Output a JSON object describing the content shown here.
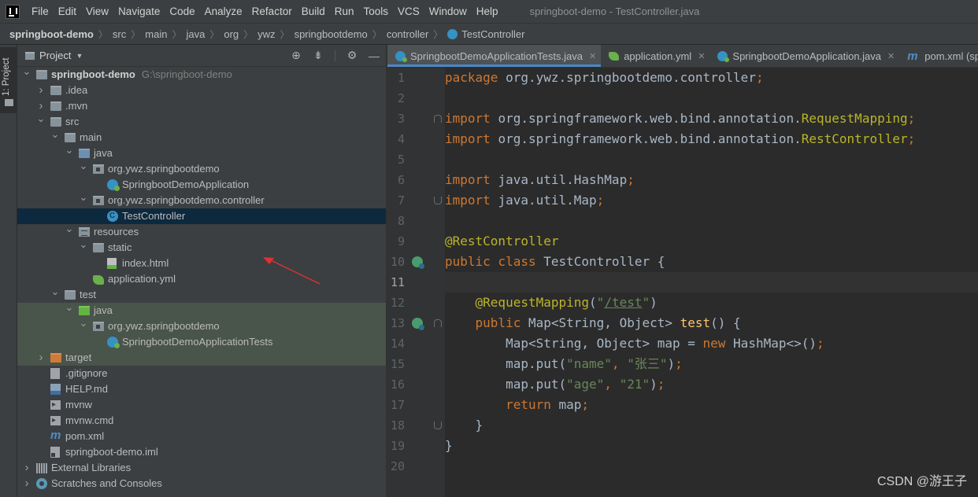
{
  "menu": {
    "items": [
      "File",
      "Edit",
      "View",
      "Navigate",
      "Code",
      "Analyze",
      "Refactor",
      "Build",
      "Run",
      "Tools",
      "VCS",
      "Window",
      "Help"
    ],
    "window_title": "springboot-demo - TestController.java"
  },
  "breadcrumb": [
    "springboot-demo",
    "src",
    "main",
    "java",
    "org",
    "ywz",
    "springbootdemo",
    "controller",
    "TestController"
  ],
  "tool_strip": {
    "project_tab": "1: Project"
  },
  "project_panel": {
    "title": "Project",
    "tree": [
      {
        "depth": 0,
        "expanded": true,
        "icon": "folder-icon",
        "label": "springboot-demo",
        "hint": "G:\\springboot-demo",
        "bold": true
      },
      {
        "depth": 1,
        "expanded": false,
        "icon": "folder-icon",
        "label": ".idea"
      },
      {
        "depth": 1,
        "expanded": false,
        "icon": "folder-icon",
        "label": ".mvn"
      },
      {
        "depth": 1,
        "expanded": true,
        "icon": "folder-icon",
        "label": "src"
      },
      {
        "depth": 2,
        "expanded": true,
        "icon": "folder-icon",
        "label": "main"
      },
      {
        "depth": 3,
        "expanded": true,
        "icon": "source-folder-icon",
        "label": "java"
      },
      {
        "depth": 4,
        "expanded": true,
        "icon": "package-icon",
        "label": "org.ywz.springbootdemo"
      },
      {
        "depth": 5,
        "icon": "spring-boot-class-icon",
        "label": "SpringbootDemoApplication"
      },
      {
        "depth": 4,
        "expanded": true,
        "icon": "package-icon",
        "label": "org.ywz.springbootdemo.controller"
      },
      {
        "depth": 5,
        "icon": "class-icon",
        "label": "TestController",
        "selected": true
      },
      {
        "depth": 3,
        "expanded": true,
        "icon": "resources-folder-icon",
        "label": "resources"
      },
      {
        "depth": 4,
        "expanded": true,
        "icon": "folder-icon",
        "label": "static"
      },
      {
        "depth": 5,
        "icon": "html-file-icon",
        "label": "index.html"
      },
      {
        "depth": 4,
        "icon": "yaml-file-icon",
        "label": "application.yml"
      },
      {
        "depth": 2,
        "expanded": true,
        "icon": "folder-icon",
        "label": "test"
      },
      {
        "depth": 3,
        "expanded": true,
        "icon": "test-source-folder-icon",
        "label": "java",
        "test_source": true
      },
      {
        "depth": 4,
        "expanded": true,
        "icon": "package-icon",
        "label": "org.ywz.springbootdemo",
        "test_source": true
      },
      {
        "depth": 5,
        "icon": "spring-boot-class-icon",
        "label": "SpringbootDemoApplicationTests",
        "test_source": true
      },
      {
        "depth": 1,
        "expanded": false,
        "icon": "excluded-folder-icon",
        "label": "target",
        "test_source": true
      },
      {
        "depth": 1,
        "icon": "gitignore-file-icon",
        "label": ".gitignore"
      },
      {
        "depth": 1,
        "icon": "markdown-file-icon",
        "label": "HELP.md"
      },
      {
        "depth": 1,
        "icon": "script-file-icon",
        "label": "mvnw"
      },
      {
        "depth": 1,
        "icon": "script-file-icon",
        "label": "mvnw.cmd"
      },
      {
        "depth": 1,
        "icon": "maven-icon",
        "label": "pom.xml"
      },
      {
        "depth": 1,
        "icon": "iml-file-icon",
        "label": "springboot-demo.iml"
      },
      {
        "depth": 0,
        "expanded": false,
        "icon": "libraries-icon",
        "label": "External Libraries"
      },
      {
        "depth": 0,
        "expanded": false,
        "icon": "scratches-icon",
        "label": "Scratches and Consoles"
      }
    ]
  },
  "editor_tabs": [
    {
      "label": "SpringbootDemoApplicationTests.java",
      "icon": "spring",
      "active": true
    },
    {
      "label": "application.yml",
      "icon": "yml"
    },
    {
      "label": "SpringbootDemoApplication.java",
      "icon": "spring"
    },
    {
      "label": "pom.xml (sp",
      "icon": "maven"
    }
  ],
  "editor": {
    "current_line": 11,
    "lines": [
      {
        "n": "1",
        "tokens": [
          [
            "kw",
            "package "
          ],
          [
            "plain",
            "org.ywz.springbootdemo.controller"
          ],
          [
            "kw",
            ";"
          ]
        ]
      },
      {
        "n": "2",
        "tokens": []
      },
      {
        "n": "3",
        "fold": "start",
        "tokens": [
          [
            "kw",
            "import "
          ],
          [
            "plain",
            "org.springframework.web.bind.annotation."
          ],
          [
            "ann",
            "RequestMapping"
          ],
          [
            "kw",
            ";"
          ]
        ]
      },
      {
        "n": "4",
        "tokens": [
          [
            "kw",
            "import "
          ],
          [
            "plain",
            "org.springframework.web.bind.annotation."
          ],
          [
            "ann",
            "RestController"
          ],
          [
            "kw",
            ";"
          ]
        ]
      },
      {
        "n": "5",
        "tokens": []
      },
      {
        "n": "6",
        "tokens": [
          [
            "kw",
            "import "
          ],
          [
            "plain",
            "java.util.HashMap"
          ],
          [
            "kw",
            ";"
          ]
        ]
      },
      {
        "n": "7",
        "fold": "end",
        "tokens": [
          [
            "kw",
            "import "
          ],
          [
            "plain",
            "java.util.Map"
          ],
          [
            "kw",
            ";"
          ]
        ]
      },
      {
        "n": "8",
        "tokens": []
      },
      {
        "n": "9",
        "tokens": [
          [
            "ann",
            "@RestController"
          ]
        ]
      },
      {
        "n": "10",
        "bean": true,
        "tokens": [
          [
            "kw",
            "public class "
          ],
          [
            "plain",
            "TestController {"
          ]
        ]
      },
      {
        "n": "11",
        "tokens": []
      },
      {
        "n": "12",
        "tokens": [
          [
            "plain",
            "    "
          ],
          [
            "ann",
            "@RequestMapping"
          ],
          [
            "plain",
            "("
          ],
          [
            "str",
            "\""
          ],
          [
            "str under",
            "/test"
          ],
          [
            "str",
            "\""
          ],
          [
            "plain",
            ")"
          ]
        ]
      },
      {
        "n": "13",
        "bean": true,
        "fold": "start",
        "tokens": [
          [
            "plain",
            "    "
          ],
          [
            "kw",
            "public "
          ],
          [
            "plain",
            "Map<String, Object> "
          ],
          [
            "fn",
            "test"
          ],
          [
            "plain",
            "() {"
          ]
        ]
      },
      {
        "n": "14",
        "tokens": [
          [
            "plain",
            "        Map<String, Object> map = "
          ],
          [
            "kw",
            "new "
          ],
          [
            "plain",
            "HashMap<>()"
          ],
          [
            "kw",
            ";"
          ]
        ]
      },
      {
        "n": "15",
        "tokens": [
          [
            "plain",
            "        map.put("
          ],
          [
            "str",
            "\"name\""
          ],
          [
            "kw",
            ", "
          ],
          [
            "str",
            "\"张三\""
          ],
          [
            "plain",
            ")"
          ],
          [
            "kw",
            ";"
          ]
        ]
      },
      {
        "n": "16",
        "tokens": [
          [
            "plain",
            "        map.put("
          ],
          [
            "str",
            "\"age\""
          ],
          [
            "kw",
            ", "
          ],
          [
            "str",
            "\"21\""
          ],
          [
            "plain",
            ")"
          ],
          [
            "kw",
            ";"
          ]
        ]
      },
      {
        "n": "17",
        "tokens": [
          [
            "plain",
            "        "
          ],
          [
            "kw",
            "return "
          ],
          [
            "plain",
            "map"
          ],
          [
            "kw",
            ";"
          ]
        ]
      },
      {
        "n": "18",
        "fold": "end",
        "tokens": [
          [
            "plain",
            "    }"
          ]
        ]
      },
      {
        "n": "19",
        "tokens": [
          [
            "plain",
            "}"
          ]
        ]
      },
      {
        "n": "20",
        "tokens": []
      }
    ]
  },
  "watermark": "CSDN @游王子",
  "colors": {
    "annotation_arrow": "#e03030",
    "selection": "#0d293e",
    "test_source_bg": "#49544a"
  }
}
